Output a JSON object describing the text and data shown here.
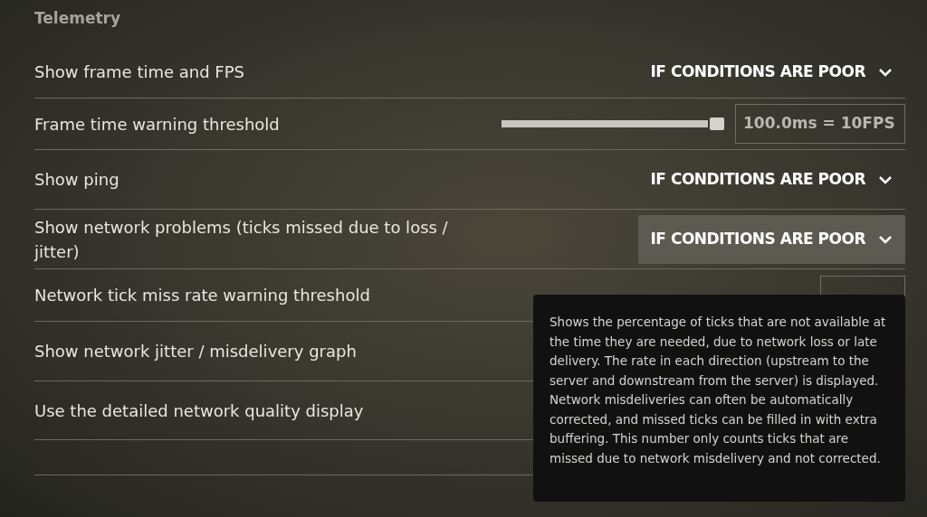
{
  "section_title": "Telemetry",
  "settings": [
    {
      "kind": "dropdown",
      "label": "Show frame time and FPS",
      "value": "IF CONDITIONS ARE POOR",
      "hovered": false
    },
    {
      "kind": "slider",
      "label": "Frame time warning threshold",
      "reading": "100.0ms = 10FPS"
    },
    {
      "kind": "dropdown",
      "label": "Show ping",
      "value": "IF CONDITIONS ARE POOR",
      "hovered": false
    },
    {
      "kind": "dropdown",
      "label": "Show network problems (ticks missed due to loss / jitter)",
      "value": "IF CONDITIONS ARE POOR",
      "hovered": true
    },
    {
      "kind": "covered_field",
      "label": "Network tick miss rate warning threshold"
    },
    {
      "kind": "covered",
      "label": "Show network jitter / misdelivery graph"
    },
    {
      "kind": "covered",
      "label": "Use the detailed network quality display"
    }
  ],
  "tooltip": {
    "text": "Shows the percentage of ticks that are not available at the time they are needed, due to network loss or late delivery. The rate in each direction (upstream to the server and downstream from the server) is displayed. Network misdeliveries can often be automatically corrected, and missed ticks can be filled in with extra buffering. This number only counts ticks that are missed due to network misdelivery and not corrected."
  }
}
